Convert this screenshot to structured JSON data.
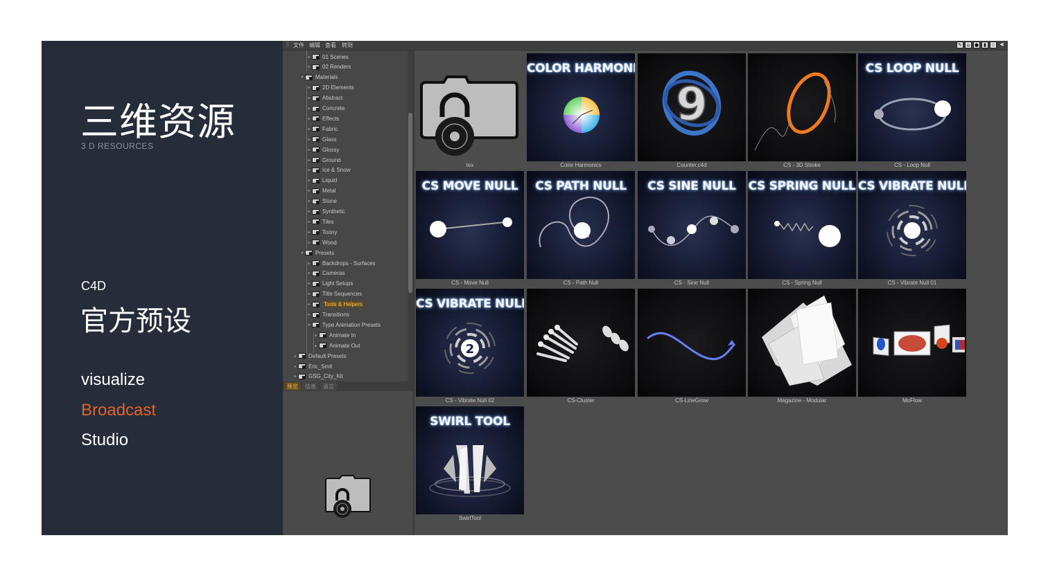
{
  "slide": {
    "title_cn": "三维资源",
    "title_en": "3 D RESOURCES",
    "c4d_label": "C4D",
    "preset_cn": "官方预设",
    "menu": [
      {
        "label": "visualize",
        "active": false
      },
      {
        "label": "Broadcast",
        "active": true
      },
      {
        "label": "Studio",
        "active": false
      }
    ],
    "accent_color": "#e0632f"
  },
  "browser": {
    "menubar": [
      "文件",
      "编辑",
      "查看",
      "转到"
    ],
    "tree": [
      {
        "label": "01 Scenes",
        "level": 3
      },
      {
        "label": "02 Renders",
        "level": 3
      },
      {
        "label": "Materials",
        "level": 2,
        "expanded": true
      },
      {
        "label": "2D Elements",
        "level": 3
      },
      {
        "label": "Abstract",
        "level": 3
      },
      {
        "label": "Concrete",
        "level": 3
      },
      {
        "label": "Effects",
        "level": 3
      },
      {
        "label": "Fabric",
        "level": 3
      },
      {
        "label": "Glass",
        "level": 3
      },
      {
        "label": "Glossy",
        "level": 3
      },
      {
        "label": "Ground",
        "level": 3
      },
      {
        "label": "Ice & Snow",
        "level": 3
      },
      {
        "label": "Liquid",
        "level": 3
      },
      {
        "label": "Metal",
        "level": 3
      },
      {
        "label": "Stone",
        "level": 3
      },
      {
        "label": "Synthetic",
        "level": 3
      },
      {
        "label": "Tiles",
        "level": 3
      },
      {
        "label": "Toony",
        "level": 3
      },
      {
        "label": "Wood",
        "level": 3
      },
      {
        "label": "Presets",
        "level": 2,
        "expanded": true
      },
      {
        "label": "Backdrops - Surfaces",
        "level": 3
      },
      {
        "label": "Cameras",
        "level": 3
      },
      {
        "label": "Light Setups",
        "level": 3
      },
      {
        "label": "Title Sequences",
        "level": 3
      },
      {
        "label": "Tools & Helpers",
        "level": 3,
        "selected": true
      },
      {
        "label": "Transitions",
        "level": 3
      },
      {
        "label": "Type Animation Presets",
        "level": 3,
        "expanded": true
      },
      {
        "label": "Animate In",
        "level": 4
      },
      {
        "label": "Animate Out",
        "level": 4
      },
      {
        "label": "Default Presets",
        "level": 1
      },
      {
        "label": "Eric_Smit",
        "level": 1
      },
      {
        "label": "GSG_City_Kit",
        "level": 1
      }
    ],
    "tabs": [
      {
        "label": "预览",
        "active": true
      },
      {
        "label": "信息",
        "active": false
      },
      {
        "label": "语言",
        "active": false
      }
    ],
    "tiles": [
      {
        "label": "tex",
        "title": "",
        "art": "lock"
      },
      {
        "label": "Color Harmonics",
        "title": "COLOR HARMONICS",
        "art": "color-wheel"
      },
      {
        "label": "Counter.c4d",
        "title": "",
        "art": "counter"
      },
      {
        "label": "CS - 3D Stroke",
        "title": "",
        "art": "stroke"
      },
      {
        "label": "CS - Loop Null",
        "title": "CS LOOP NULL",
        "art": "loop"
      },
      {
        "label": "CS - Move Null",
        "title": "CS MOVE NULL",
        "art": "move"
      },
      {
        "label": "CS - Path Null",
        "title": "CS PATH NULL",
        "art": "path"
      },
      {
        "label": "CS - Sine Null",
        "title": "CS SINE NULL",
        "art": "sine"
      },
      {
        "label": "CS - Spring Null",
        "title": "CS SPRING NULL",
        "art": "spring"
      },
      {
        "label": "CS - Vibrate Null 01",
        "title": "CS VIBRATE NULL",
        "art": "vibrate1"
      },
      {
        "label": "CS - Vibrate Null 02",
        "title": "CS VIBRATE NULL",
        "art": "vibrate2"
      },
      {
        "label": "CS-Cluster",
        "title": "",
        "art": "cluster"
      },
      {
        "label": "CS-LineGrow",
        "title": "",
        "art": "linegrow"
      },
      {
        "label": "Magazine - Modular",
        "title": "",
        "art": "magazine"
      },
      {
        "label": "MoFlow",
        "title": "",
        "art": "moflow"
      },
      {
        "label": "SwirlTool",
        "title": "SWIRL TOOL",
        "art": "swirl"
      }
    ],
    "vibrate2_badge": "2",
    "counter_digit": "9"
  }
}
